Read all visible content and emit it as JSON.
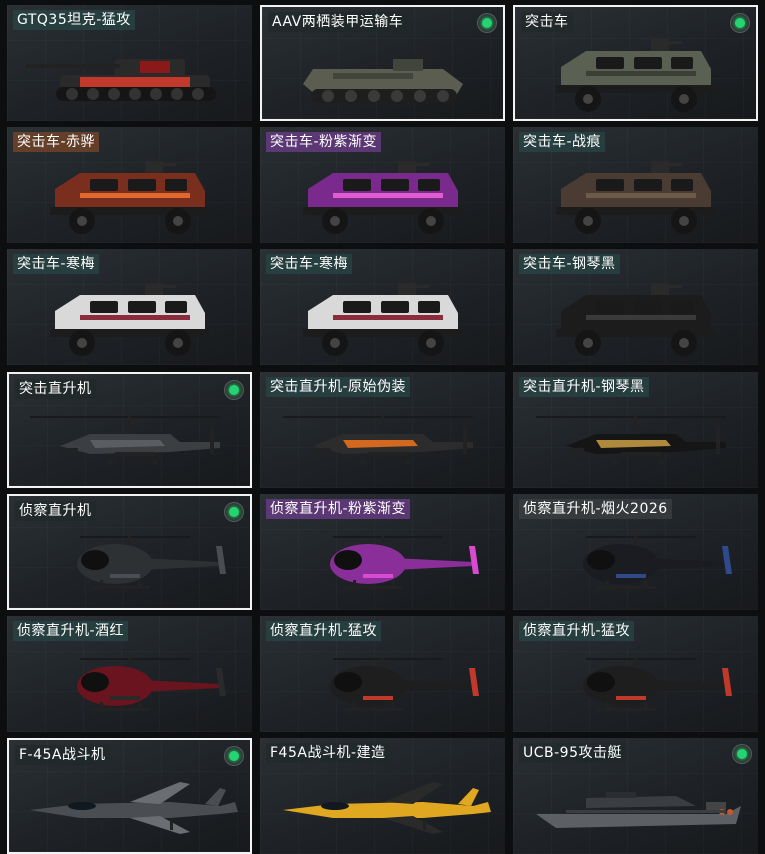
{
  "items": [
    {
      "label": "GTQ35坦克-猛攻",
      "owned": false,
      "selected": false,
      "kind": "tank",
      "tag": "teal",
      "body": "#2a2a2a",
      "accent": "#c0392b"
    },
    {
      "label": "AAV两栖装甲运输车",
      "owned": true,
      "selected": true,
      "kind": "apc",
      "tag": "default",
      "body": "#5a5d50",
      "accent": "#42453c"
    },
    {
      "label": "突击车",
      "owned": true,
      "selected": true,
      "kind": "truck",
      "tag": "default",
      "body": "#5b6152",
      "accent": "#3b3f35"
    },
    {
      "label": "突击车-赤骅",
      "owned": false,
      "selected": false,
      "kind": "truck",
      "tag": "orange",
      "body": "#7a2f1e",
      "accent": "#e0682a"
    },
    {
      "label": "突击车-粉紫渐变",
      "owned": false,
      "selected": false,
      "kind": "truck",
      "tag": "purple",
      "body": "#7a2a8c",
      "accent": "#e05ad0"
    },
    {
      "label": "突击车-战痕",
      "owned": false,
      "selected": false,
      "kind": "truck",
      "tag": "teal",
      "body": "#4a3c32",
      "accent": "#6e5a48"
    },
    {
      "label": "突击车-寒梅",
      "owned": false,
      "selected": false,
      "kind": "truck",
      "tag": "teal",
      "body": "#d9d9d9",
      "accent": "#8a2c3c"
    },
    {
      "label": "突击车-寒梅",
      "owned": false,
      "selected": false,
      "kind": "truck",
      "tag": "teal",
      "body": "#d9d9d9",
      "accent": "#8a2c3c"
    },
    {
      "label": "突击车-钢琴黑",
      "owned": false,
      "selected": false,
      "kind": "truck",
      "tag": "teal",
      "body": "#1c1c1c",
      "accent": "#3a3a3a"
    },
    {
      "label": "突击直升机",
      "owned": true,
      "selected": true,
      "kind": "attack-heli",
      "tag": "default",
      "body": "#3c3f42",
      "accent": "#5a5e62"
    },
    {
      "label": "突击直升机-原始伪装",
      "owned": false,
      "selected": false,
      "kind": "attack-heli",
      "tag": "teal",
      "body": "#2c2c2c",
      "accent": "#d2691e"
    },
    {
      "label": "突击直升机-钢琴黑",
      "owned": false,
      "selected": false,
      "kind": "attack-heli",
      "tag": "teal",
      "body": "#151515",
      "accent": "#b08a3c"
    },
    {
      "label": "侦察直升机",
      "owned": true,
      "selected": true,
      "kind": "scout-heli",
      "tag": "default",
      "body": "#2e3134",
      "accent": "#4a4e52"
    },
    {
      "label": "侦察直升机-粉紫渐变",
      "owned": false,
      "selected": false,
      "kind": "scout-heli",
      "tag": "purple",
      "body": "#8a2e9a",
      "accent": "#d84ad0"
    },
    {
      "label": "侦察直升机-烟火2026",
      "owned": false,
      "selected": false,
      "kind": "scout-heli",
      "tag": "grey",
      "body": "#1a1c22",
      "accent": "#2e4a8a"
    },
    {
      "label": "侦察直升机-酒红",
      "owned": false,
      "selected": false,
      "kind": "scout-heli",
      "tag": "teal",
      "body": "#6a1420",
      "accent": "#2a2a2a"
    },
    {
      "label": "侦察直升机-猛攻",
      "owned": false,
      "selected": false,
      "kind": "scout-heli",
      "tag": "teal",
      "body": "#1e1e1e",
      "accent": "#c0392b"
    },
    {
      "label": "侦察直升机-猛攻",
      "owned": false,
      "selected": false,
      "kind": "scout-heli",
      "tag": "teal",
      "body": "#1e1e1e",
      "accent": "#c0392b"
    },
    {
      "label": "F-45A战斗机",
      "owned": true,
      "selected": true,
      "kind": "jet",
      "tag": "default",
      "body": "#4a4e52",
      "accent": "#6a6e72"
    },
    {
      "label": "F45A战斗机-建造",
      "owned": false,
      "selected": false,
      "kind": "jet",
      "tag": "default",
      "body": "#e0a820",
      "accent": "#2a2a2a"
    },
    {
      "label": "UCB-95攻击艇",
      "owned": true,
      "selected": false,
      "kind": "boat",
      "tag": "default",
      "body": "#5c6064",
      "accent": "#3a3e42"
    }
  ]
}
